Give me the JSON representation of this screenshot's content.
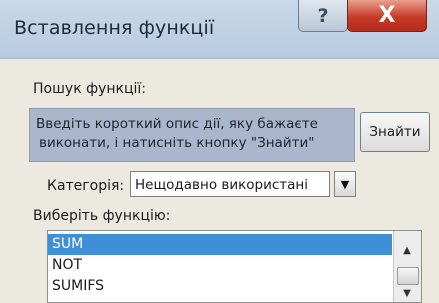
{
  "dialog": {
    "title": "Вставлення функції",
    "help_glyph": "?",
    "close_glyph": "X"
  },
  "search": {
    "label": "Пошук функції:",
    "value_line1": "Введіть короткий опис дії, яку бажаєте",
    "value_line2": "виконати, і натисніть  кнопку \"Знайти\"",
    "find_button": "Знайти"
  },
  "category": {
    "label": "Категорія:",
    "selected": "Нещодавно використані"
  },
  "function_list": {
    "label": "Виберіть функцію:",
    "items": [
      "SUM",
      "NOT",
      "SUMIFS"
    ],
    "selected_index": 0
  },
  "colors": {
    "selection": "#3e8ed8",
    "close_button": "#c63a27",
    "search_box": "#a9b6cb"
  }
}
